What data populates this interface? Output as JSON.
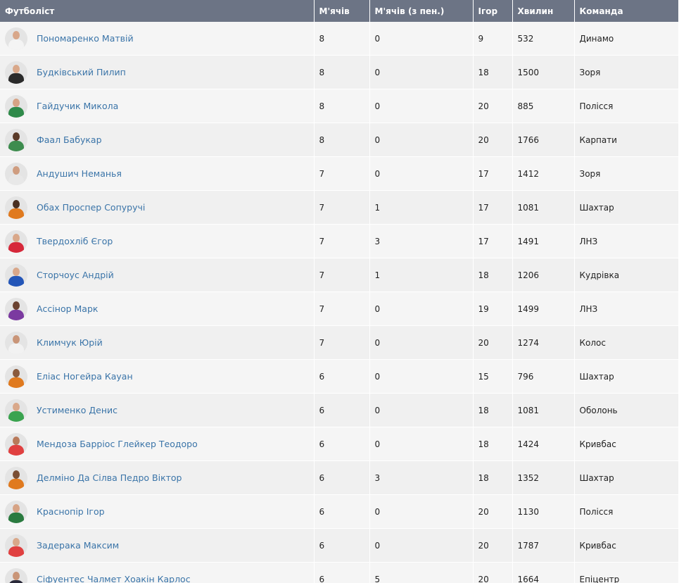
{
  "table": {
    "headers": {
      "player": "Футболіст",
      "goals": "М'ячів",
      "pen": "М'ячів (з пен.)",
      "games": "Ігор",
      "minutes": "Хвилин",
      "team": "Команда"
    },
    "rows": [
      {
        "player": "Пономаренко Матвій",
        "goals": "8",
        "pen": "0",
        "games": "9",
        "minutes": "532",
        "team": "Динамо",
        "kit": "#f4f4f4",
        "skin": "#d8a78a"
      },
      {
        "player": "Будківський Пилип",
        "goals": "8",
        "pen": "0",
        "games": "18",
        "minutes": "1500",
        "team": "Зоря",
        "kit": "#2b2b2b",
        "skin": "#d9a88a"
      },
      {
        "player": "Гайдучик Микола",
        "goals": "8",
        "pen": "0",
        "games": "20",
        "minutes": "885",
        "team": "Полісся",
        "kit": "#2f8a4a",
        "skin": "#d6a385"
      },
      {
        "player": "Фаал Бабукар",
        "goals": "8",
        "pen": "0",
        "games": "20",
        "minutes": "1766",
        "team": "Карпати",
        "kit": "#3d8c4e",
        "skin": "#5a3a28"
      },
      {
        "player": "Андушич Неманья",
        "goals": "7",
        "pen": "0",
        "games": "17",
        "minutes": "1412",
        "team": "Зоря",
        "kit": "#e8e8e8",
        "skin": "#cf9d80"
      },
      {
        "player": "Обах Проспер Сопуручі",
        "goals": "7",
        "pen": "1",
        "games": "17",
        "minutes": "1081",
        "team": "Шахтар",
        "kit": "#e07a1f",
        "skin": "#4a2f20"
      },
      {
        "player": "Твердохліб Єгор",
        "goals": "7",
        "pen": "3",
        "games": "17",
        "minutes": "1491",
        "team": "ЛНЗ",
        "kit": "#d6283a",
        "skin": "#d9a88a"
      },
      {
        "player": "Сторчоус Андрій",
        "goals": "7",
        "pen": "1",
        "games": "18",
        "minutes": "1206",
        "team": "Кудрівка",
        "kit": "#2456b8",
        "skin": "#d8a78a"
      },
      {
        "player": "Ассінор Марк",
        "goals": "7",
        "pen": "0",
        "games": "19",
        "minutes": "1499",
        "team": "ЛНЗ",
        "kit": "#7b3aa0",
        "skin": "#6a4230"
      },
      {
        "player": "Климчук Юрій",
        "goals": "7",
        "pen": "0",
        "games": "20",
        "minutes": "1274",
        "team": "Колос",
        "kit": "#f2f2f2",
        "skin": "#c99578"
      },
      {
        "player": "Еліас Ногейра Кауан",
        "goals": "6",
        "pen": "0",
        "games": "15",
        "minutes": "796",
        "team": "Шахтар",
        "kit": "#e07a1f",
        "skin": "#8a5a3c"
      },
      {
        "player": "Устименко Денис",
        "goals": "6",
        "pen": "0",
        "games": "18",
        "minutes": "1081",
        "team": "Оболонь",
        "kit": "#3aa34f",
        "skin": "#d9a88a"
      },
      {
        "player": "Мендоза Барріос Глейкер Теодоро",
        "goals": "6",
        "pen": "0",
        "games": "18",
        "minutes": "1424",
        "team": "Кривбас",
        "kit": "#e04040",
        "skin": "#b87a5a"
      },
      {
        "player": "Делміно Да Сілва Педро Віктор",
        "goals": "6",
        "pen": "3",
        "games": "18",
        "minutes": "1352",
        "team": "Шахтар",
        "kit": "#e07a1f",
        "skin": "#7a4e34"
      },
      {
        "player": "Краснопір Ігор",
        "goals": "6",
        "pen": "0",
        "games": "20",
        "minutes": "1130",
        "team": "Полісся",
        "kit": "#2a7a3f",
        "skin": "#d6a385"
      },
      {
        "player": "Задерака Максим",
        "goals": "6",
        "pen": "0",
        "games": "20",
        "minutes": "1787",
        "team": "Кривбас",
        "kit": "#e04040",
        "skin": "#d9a88a"
      },
      {
        "player": "Сіфуентес Чалмет Хоакін Карлос",
        "goals": "6",
        "pen": "5",
        "games": "20",
        "minutes": "1664",
        "team": "Епіцентр",
        "kit": "#2a2a3a",
        "skin": "#c99578"
      }
    ]
  }
}
